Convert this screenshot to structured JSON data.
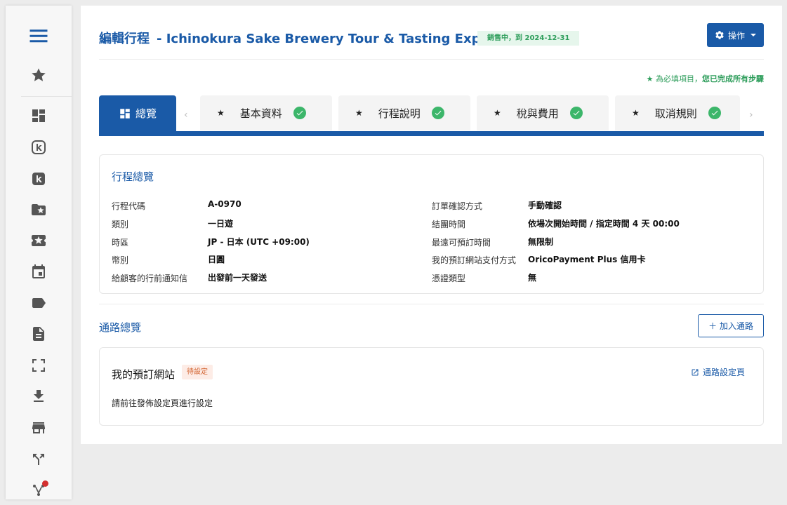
{
  "sidebar": {
    "icons": [
      "menu-icon",
      "star-icon",
      "dashboard-icon",
      "k-outline-icon",
      "k-filled-icon",
      "folder-star-icon",
      "ticket-star-icon",
      "calendar-icon",
      "label-icon",
      "document-icon",
      "fullscreen-icon",
      "download-icon",
      "store-icon",
      "merge-icon",
      "fork-icon"
    ]
  },
  "header": {
    "title_prefix": "編輯行程",
    "title_name": "- Ichinokura Sake Brewery Tour & Tasting Experience",
    "status_badge": "銷售中，到 2024-12-31",
    "action_label": "操作"
  },
  "required_note": {
    "text": "★ 為必填項目，",
    "done": "您已完成所有步驟"
  },
  "tabs": {
    "active_label": "總覽",
    "prev_arrow": "‹",
    "next_arrow": "›",
    "items": [
      {
        "star": "★",
        "label": "基本資料"
      },
      {
        "star": "★",
        "label": "行程說明"
      },
      {
        "star": "★",
        "label": "稅與費用"
      },
      {
        "star": "★",
        "label": "取消規則"
      }
    ]
  },
  "overview": {
    "title": "行程總覽",
    "left": [
      {
        "label": "行程代碼",
        "value": "A-0970"
      },
      {
        "label": "類別",
        "value": "一日遊"
      },
      {
        "label": "時區",
        "value": "JP - 日本 (UTC +09:00)"
      },
      {
        "label": "幣別",
        "value": "日圓"
      },
      {
        "label": "給顧客的行前通知信",
        "value": "出發前一天發送"
      }
    ],
    "right": [
      {
        "label": "訂單確認方式",
        "value": "手動確認"
      },
      {
        "label": "結團時間",
        "value": "依場次開始時間 / 指定時間 4 天 00:00"
      },
      {
        "label": "最遠可預訂時間",
        "value": "無限制"
      },
      {
        "label": "我的預訂網站支付方式",
        "value": "OricoPayment Plus 信用卡"
      },
      {
        "label": "憑證類型",
        "value": "無"
      }
    ]
  },
  "channels": {
    "title": "通路總覽",
    "add_label": "＋ 加入通路",
    "card": {
      "name": "我的預訂網站",
      "badge": "待設定",
      "link_label": "通路設定頁",
      "hint": "請前往發佈設定頁進行設定"
    }
  },
  "colors": {
    "brand": "#1a5aa7",
    "success": "#3cb66a",
    "pending": "#d2622e",
    "notification_dot": "#d32f2f"
  }
}
